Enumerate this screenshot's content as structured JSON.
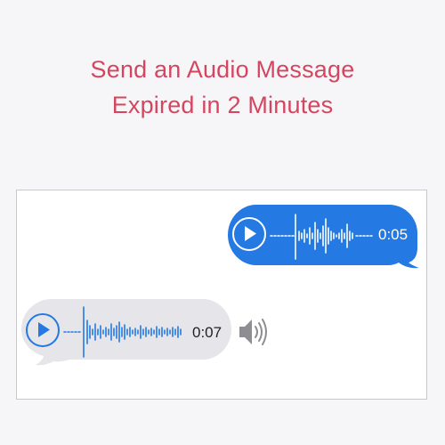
{
  "header": {
    "line1": "Send an Audio Message",
    "line2": "Expired in 2 Minutes"
  },
  "colors": {
    "heading": "#d64560",
    "sent_bubble": "#2479e3",
    "received_bubble": "#e6e6ea",
    "received_accent": "#2479e3",
    "speaker": "#8d8d92"
  },
  "messages": {
    "sent": {
      "duration": "0:05"
    },
    "received": {
      "duration": "0:07"
    }
  },
  "icons": {
    "play": "play-icon",
    "speaker": "speaker-icon"
  }
}
